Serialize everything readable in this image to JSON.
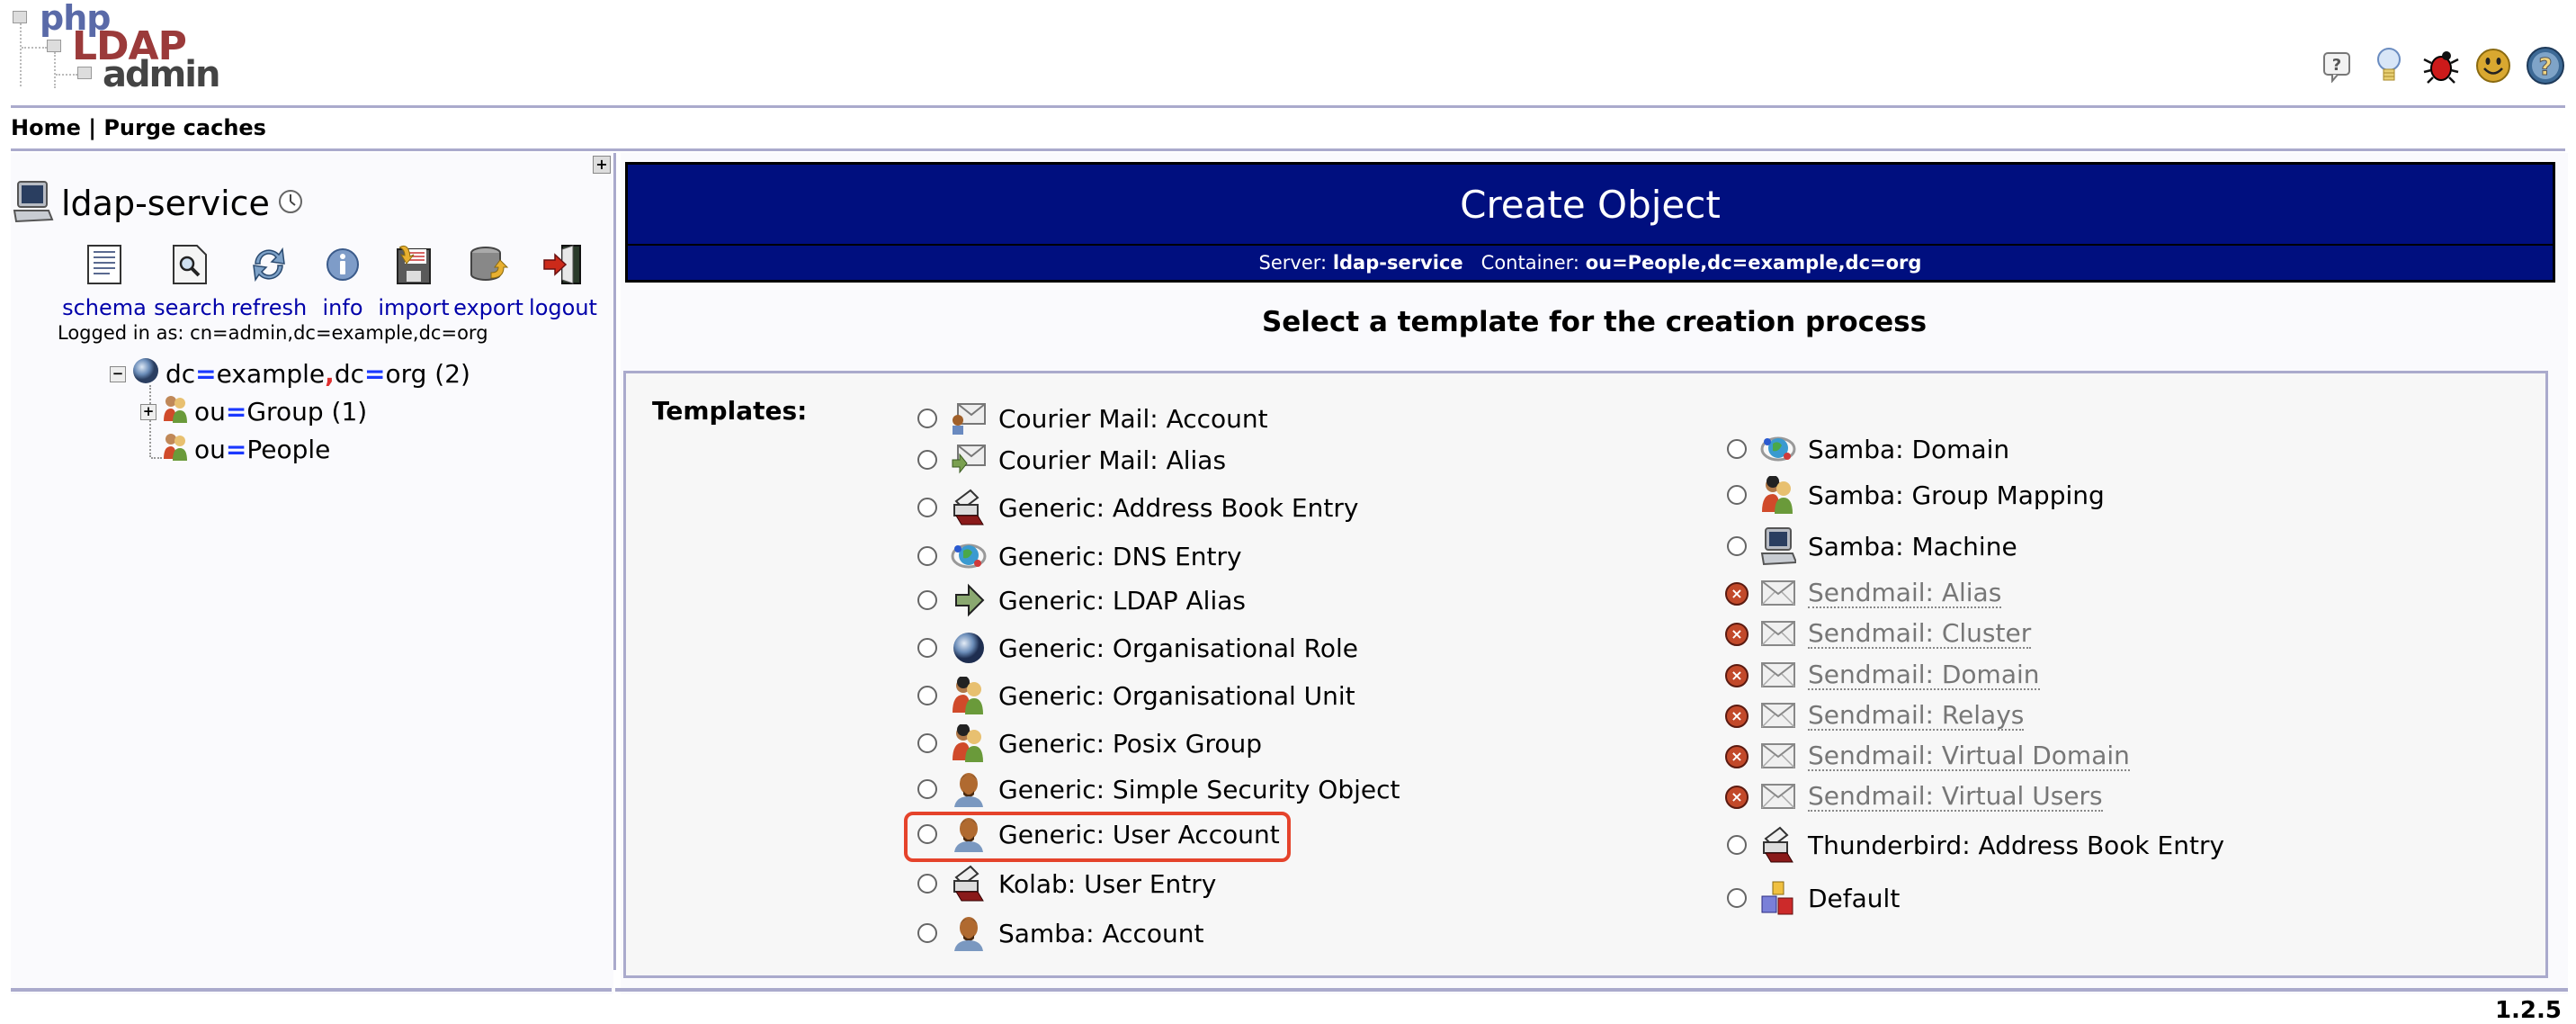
{
  "app": {
    "logo": {
      "line1": "php",
      "line2": "LDAP",
      "line3": "admin"
    },
    "top_icons": [
      {
        "name": "help-bubble-icon",
        "title": "Help"
      },
      {
        "name": "lightbulb-icon",
        "title": "Request feature"
      },
      {
        "name": "bug-icon",
        "title": "Report a bug"
      },
      {
        "name": "smiley-icon",
        "title": "Donate"
      },
      {
        "name": "question-icon",
        "title": "Help"
      }
    ],
    "menu": {
      "home": "Home",
      "separator": "|",
      "purge": "Purge caches"
    },
    "version": "1.2.5"
  },
  "sidebar": {
    "expand_label": "+",
    "server_name": "ldap-service",
    "tools": [
      {
        "icon": "schema-icon",
        "label": "schema"
      },
      {
        "icon": "search-icon",
        "label": "search"
      },
      {
        "icon": "refresh-icon",
        "label": "refresh"
      },
      {
        "icon": "info-icon",
        "label": "info"
      },
      {
        "icon": "import-icon",
        "label": "import"
      },
      {
        "icon": "export-icon",
        "label": "export"
      },
      {
        "icon": "logout-icon",
        "label": "logout"
      }
    ],
    "logged_in": "Logged in as: cn=admin,dc=example,dc=org",
    "tree": {
      "root": {
        "toggle": "−",
        "a1": "dc",
        "eq": "=",
        "v1": "example",
        "comma": ",",
        "a2": "dc",
        "v2": "org",
        "count": "(2)"
      },
      "children": [
        {
          "toggle": "+",
          "attr": "ou",
          "eq": "=",
          "value": "Group",
          "count": "(1)"
        },
        {
          "toggle": "",
          "attr": "ou",
          "eq": "=",
          "value": "People",
          "count": ""
        }
      ]
    }
  },
  "main": {
    "title": "Create Object",
    "server_label": "Server:",
    "server_value": "ldap-service",
    "container_label": "Container:",
    "container_value": "ou=People,dc=example,dc=org",
    "select_heading": "Select a template for the creation process",
    "templates_label": "Templates:",
    "templates_left": [
      {
        "label": "Courier Mail: Account",
        "icon": "mail-user-icon",
        "enabled": true
      },
      {
        "label": "Courier Mail: Alias",
        "icon": "mail-alias-icon",
        "enabled": true
      },
      {
        "label": "Generic: Address Book Entry",
        "icon": "address-book-icon",
        "enabled": true
      },
      {
        "label": "Generic: DNS Entry",
        "icon": "dns-icon",
        "enabled": true
      },
      {
        "label": "Generic: LDAP Alias",
        "icon": "arrow-right-icon",
        "enabled": true
      },
      {
        "label": "Generic: Organisational Role",
        "icon": "globe-icon",
        "enabled": true
      },
      {
        "label": "Generic: Organisational Unit",
        "icon": "group-icon",
        "enabled": true
      },
      {
        "label": "Generic: Posix Group",
        "icon": "group-icon",
        "enabled": true
      },
      {
        "label": "Generic: Simple Security Object",
        "icon": "user-icon",
        "enabled": true
      },
      {
        "label": "Generic: User Account",
        "icon": "user-icon",
        "enabled": true,
        "highlighted": true
      },
      {
        "label": "Kolab: User Entry",
        "icon": "address-book-icon",
        "enabled": true
      },
      {
        "label": "Samba: Account",
        "icon": "user-icon",
        "enabled": true
      }
    ],
    "templates_right": [
      {
        "label": "Samba: Domain",
        "icon": "dns-icon",
        "enabled": true
      },
      {
        "label": "Samba: Group Mapping",
        "icon": "group-icon",
        "enabled": true
      },
      {
        "label": "Samba: Machine",
        "icon": "computer-icon",
        "enabled": true
      },
      {
        "label": "Sendmail: Alias",
        "icon": "mail-icon",
        "enabled": false
      },
      {
        "label": "Sendmail: Cluster",
        "icon": "mail-icon",
        "enabled": false
      },
      {
        "label": "Sendmail: Domain",
        "icon": "mail-icon",
        "enabled": false
      },
      {
        "label": "Sendmail: Relays",
        "icon": "mail-icon",
        "enabled": false
      },
      {
        "label": "Sendmail: Virtual Domain",
        "icon": "mail-icon",
        "enabled": false
      },
      {
        "label": "Sendmail: Virtual Users",
        "icon": "mail-icon",
        "enabled": false
      },
      {
        "label": "Thunderbird: Address Book Entry",
        "icon": "address-book-icon",
        "enabled": true
      },
      {
        "label": "Default",
        "icon": "cubes-icon",
        "enabled": true
      }
    ],
    "disabled_marker": "×"
  },
  "colors": {
    "header_blue": "#000f7f",
    "divider": "#aaaacc",
    "link_blue": "#0000aa",
    "highlight_red": "#e5432b",
    "disabled_x": "#c2492a"
  }
}
